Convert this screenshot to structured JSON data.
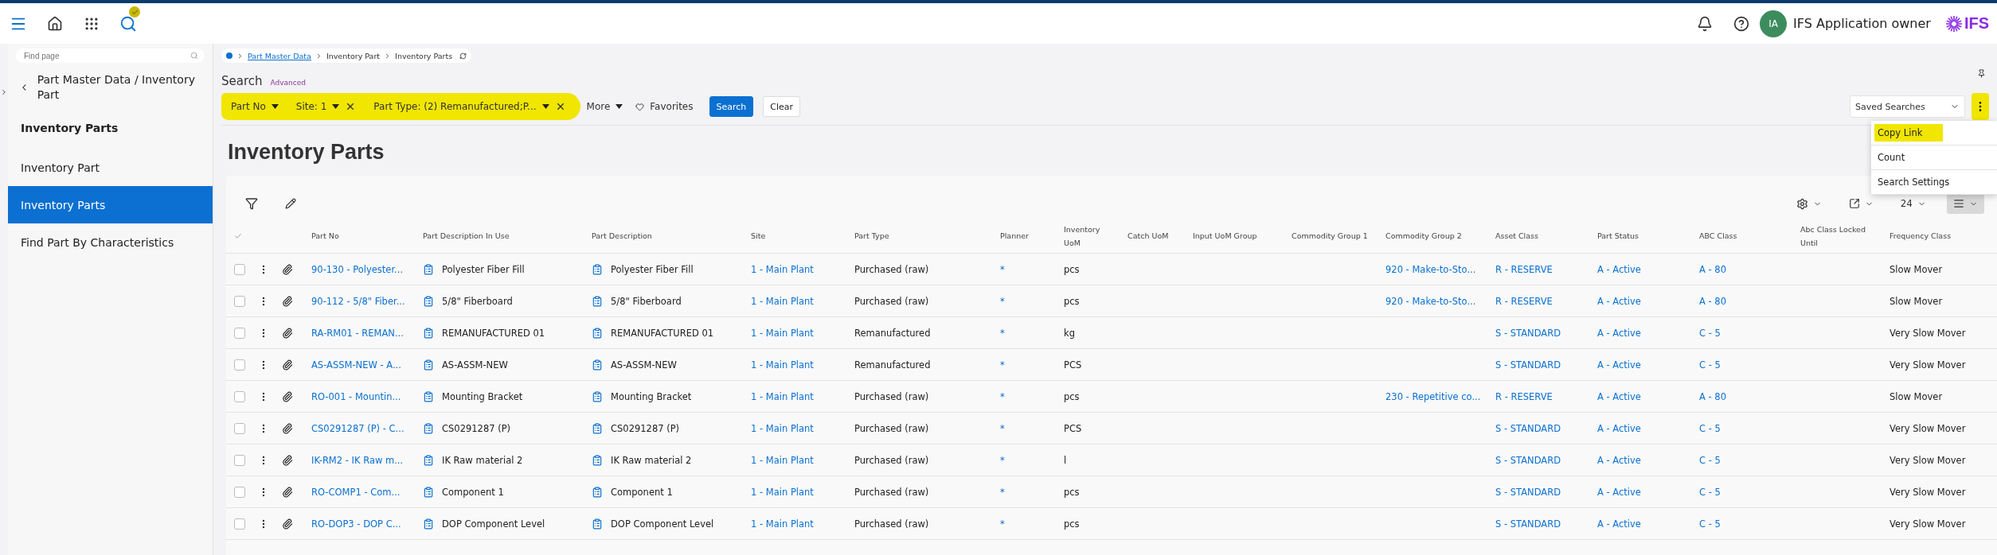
{
  "topbar": {
    "user_initials": "IA",
    "user_name": "IFS Application owner",
    "logo_text": "IFS"
  },
  "sidebar": {
    "search_placeholder": "Find page",
    "back_title": "Part Master Data / Inventory Part",
    "section_title": "Inventory Parts",
    "items": [
      {
        "label": "Inventory Part",
        "selected": false
      },
      {
        "label": "Inventory Parts",
        "selected": true
      },
      {
        "label": "Find Part By Characteristics",
        "selected": false
      }
    ]
  },
  "breadcrumb": [
    {
      "label": "Part Master Data",
      "link": true
    },
    {
      "label": "Inventory Part",
      "link": false
    },
    {
      "label": "Inventory Parts",
      "link": false
    }
  ],
  "search": {
    "title": "Search",
    "advanced": "Advanced",
    "filters_highlighted": true,
    "filters": [
      {
        "label": "Part No",
        "removable": false
      },
      {
        "label": "Site: 1",
        "removable": true
      },
      {
        "label": "Part Type: (2) Remanufactured;P...",
        "removable": true
      }
    ],
    "more": "More",
    "favorites": "Favorites",
    "search_button": "Search",
    "clear_button": "Clear",
    "saved_searches": "Saved Searches",
    "menu_button_highlighted": true
  },
  "menu": [
    {
      "label": "Copy Link",
      "highlighted": true
    },
    {
      "label": "Count",
      "highlighted": false
    },
    {
      "label": "Search Settings",
      "highlighted": false
    }
  ],
  "page_title": "Inventory Parts",
  "table": {
    "page_size": "24",
    "columns": [
      {
        "label": "Part No",
        "kind": "link"
      },
      {
        "label": "Part Description In Use",
        "kind": "doc"
      },
      {
        "label": "Part Description",
        "kind": "doc"
      },
      {
        "label": "Site",
        "kind": "link"
      },
      {
        "label": "Part Type",
        "kind": "text"
      },
      {
        "label": "Planner",
        "kind": "link"
      },
      {
        "label": "Inventory UoM",
        "kind": "text"
      },
      {
        "label": "Catch UoM"
      },
      {
        "label": "Input UoM Group"
      },
      {
        "label": "Commodity Group 1"
      },
      {
        "label": "Commodity Group 2",
        "kind": "link"
      },
      {
        "label": "Asset Class",
        "kind": "link"
      },
      {
        "label": "Part Status",
        "kind": "link"
      },
      {
        "label": "ABC Class",
        "kind": "link"
      },
      {
        "label": "Abc Class Locked Until"
      },
      {
        "label": "Frequency Class",
        "kind": "text"
      }
    ],
    "rows": [
      {
        "selected": false,
        "cells": [
          "90-130 - Polyester...",
          "Polyester Fiber Fill",
          "Polyester Fiber Fill",
          "1 - Main Plant",
          "Purchased (raw)",
          "*",
          "pcs",
          null,
          null,
          null,
          "920 - Make-to-Sto...",
          "R - RESERVE",
          "A - Active",
          "A - 80",
          null,
          "Slow Mover"
        ]
      },
      {
        "selected": false,
        "cells": [
          "90-112 - 5/8\" Fiber...",
          "5/8\" Fiberboard",
          "5/8\" Fiberboard",
          "1 - Main Plant",
          "Purchased (raw)",
          "*",
          "pcs",
          null,
          null,
          null,
          "920 - Make-to-Sto...",
          "R - RESERVE",
          "A - Active",
          "A - 80",
          null,
          "Slow Mover"
        ]
      },
      {
        "selected": false,
        "cells": [
          "RA-RM01 - REMAN...",
          "REMANUFACTURED 01",
          "REMANUFACTURED 01",
          "1 - Main Plant",
          "Remanufactured",
          "*",
          "kg",
          null,
          null,
          null,
          null,
          "S - STANDARD",
          "A - Active",
          "C - 5",
          null,
          "Very Slow Mover"
        ]
      },
      {
        "selected": false,
        "cells": [
          "AS-ASSM-NEW - A...",
          "AS-ASSM-NEW",
          "AS-ASSM-NEW",
          "1 - Main Plant",
          "Remanufactured",
          "*",
          "PCS",
          null,
          null,
          null,
          null,
          "S - STANDARD",
          "A - Active",
          "C - 5",
          null,
          "Very Slow Mover"
        ]
      },
      {
        "selected": false,
        "cells": [
          "RO-001 - Mountin...",
          "Mounting Bracket",
          "Mounting Bracket",
          "1 - Main Plant",
          "Purchased (raw)",
          "*",
          "pcs",
          null,
          null,
          null,
          "230 - Repetitive co...",
          "R - RESERVE",
          "A - Active",
          "A - 80",
          null,
          "Slow Mover"
        ]
      },
      {
        "selected": false,
        "cells": [
          "CS0291287 (P) - C...",
          "CS0291287 (P)",
          "CS0291287 (P)",
          "1 - Main Plant",
          "Purchased (raw)",
          "*",
          "PCS",
          null,
          null,
          null,
          null,
          "S - STANDARD",
          "A - Active",
          "C - 5",
          null,
          "Very Slow Mover"
        ]
      },
      {
        "selected": false,
        "cells": [
          "IK-RM2 - IK Raw m...",
          "IK Raw material 2",
          "IK Raw material 2",
          "1 - Main Plant",
          "Purchased (raw)",
          "*",
          "l",
          null,
          null,
          null,
          null,
          "S - STANDARD",
          "A - Active",
          "C - 5",
          null,
          "Very Slow Mover"
        ]
      },
      {
        "selected": false,
        "cells": [
          "RO-COMP1 - Com...",
          "Component 1",
          "Component 1",
          "1 - Main Plant",
          "Purchased (raw)",
          "*",
          "pcs",
          null,
          null,
          null,
          null,
          "S - STANDARD",
          "A - Active",
          "C - 5",
          null,
          "Very Slow Mover"
        ]
      },
      {
        "selected": false,
        "cells": [
          "RO-DOP3 - DOP C...",
          "DOP Component Level",
          "DOP Component Level",
          "1 - Main Plant",
          "Purchased (raw)",
          "*",
          "pcs",
          null,
          null,
          null,
          null,
          "S - STANDARD",
          "A - Active",
          "C - 5",
          null,
          "Very Slow Mover"
        ]
      }
    ]
  }
}
